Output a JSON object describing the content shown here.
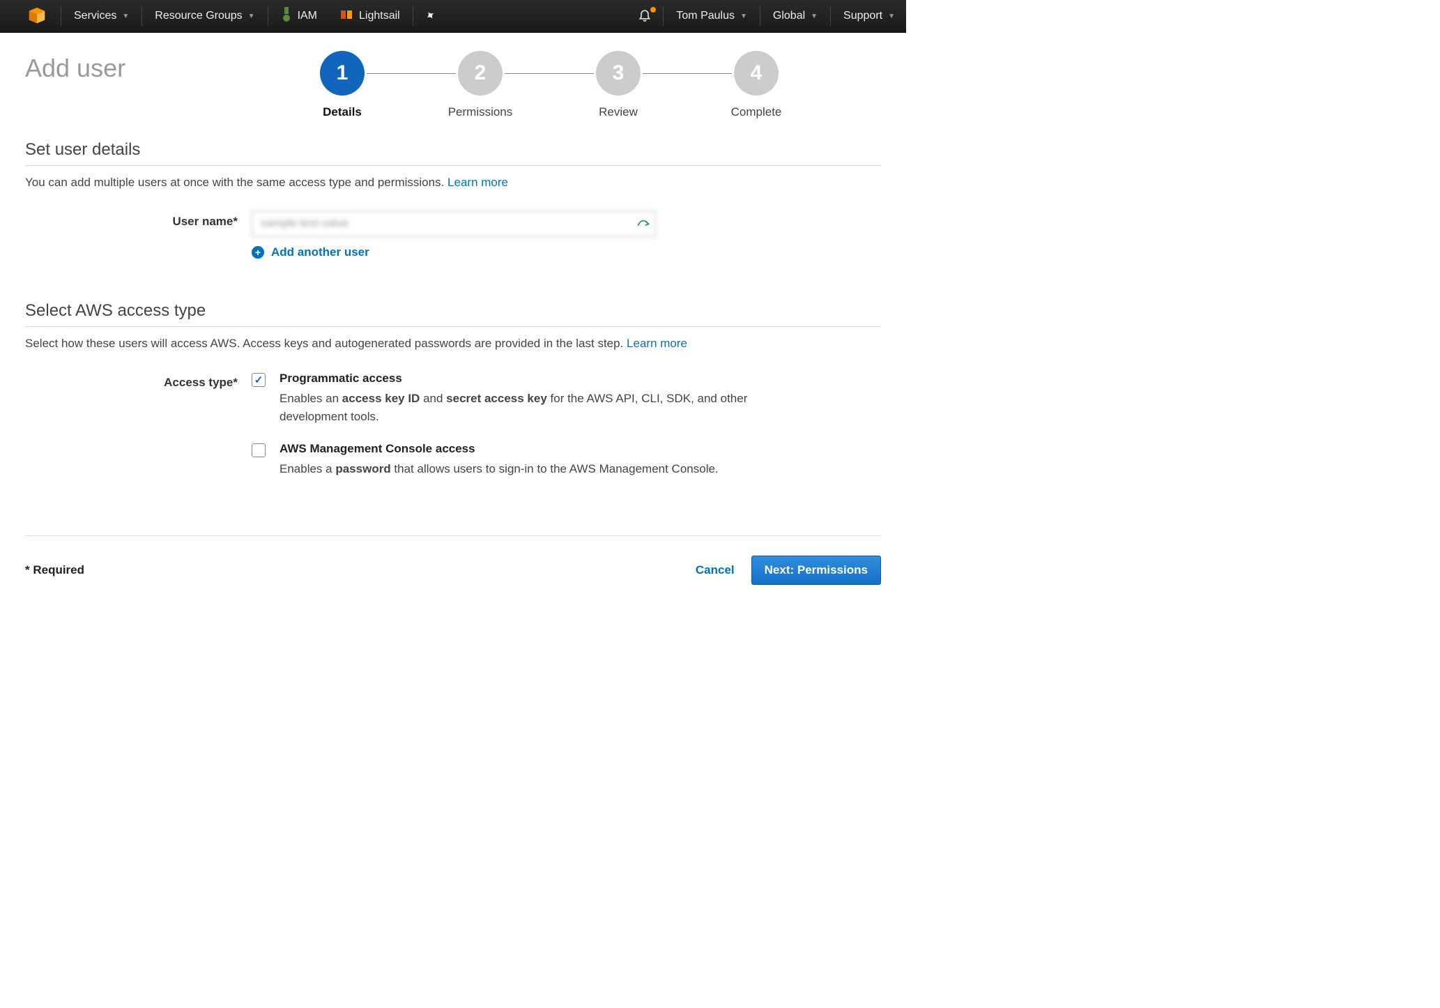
{
  "nav": {
    "services": "Services",
    "resource_groups": "Resource Groups",
    "iam": "IAM",
    "lightsail": "Lightsail",
    "user": "Tom Paulus",
    "region": "Global",
    "support": "Support"
  },
  "page": {
    "title": "Add user"
  },
  "wizard": {
    "steps": [
      {
        "num": "1",
        "label": "Details",
        "active": true
      },
      {
        "num": "2",
        "label": "Permissions",
        "active": false
      },
      {
        "num": "3",
        "label": "Review",
        "active": false
      },
      {
        "num": "4",
        "label": "Complete",
        "active": false
      }
    ]
  },
  "details_section": {
    "title": "Set user details",
    "intro": "You can add multiple users at once with the same access type and permissions. ",
    "learn_more": "Learn more",
    "username_label": "User name*",
    "username_value": "sample-text-value",
    "add_another": "Add another user"
  },
  "access_section": {
    "title": "Select AWS access type",
    "intro": "Select how these users will access AWS. Access keys and autogenerated passwords are provided in the last step. ",
    "learn_more": "Learn more",
    "label": "Access type*",
    "programmatic": {
      "title": "Programmatic access",
      "desc_pre": "Enables an ",
      "desc_b1": "access key ID",
      "desc_mid": " and ",
      "desc_b2": "secret access key",
      "desc_post": " for the AWS API, CLI, SDK, and other development tools.",
      "checked": true
    },
    "console": {
      "title": "AWS Management Console access",
      "desc_pre": "Enables a ",
      "desc_b1": "password",
      "desc_post": " that allows users to sign-in to the AWS Management Console.",
      "checked": false
    }
  },
  "footer": {
    "required": "* Required",
    "cancel": "Cancel",
    "next": "Next: Permissions"
  }
}
